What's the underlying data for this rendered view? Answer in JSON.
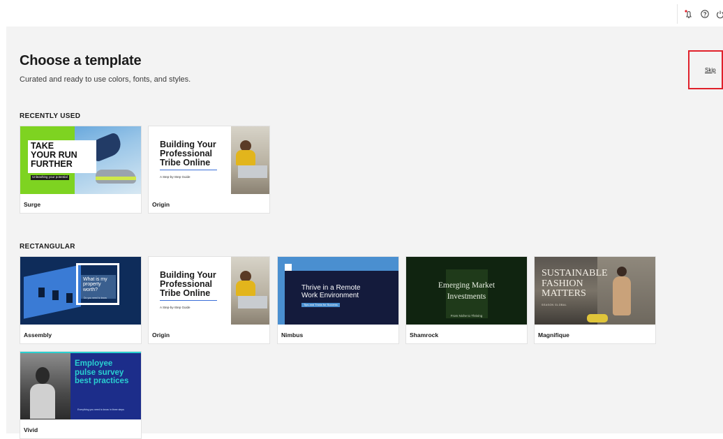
{
  "header": {
    "title": "Choose a template",
    "subtitle": "Curated and ready to use colors, fonts, and styles.",
    "skip_label": "Skip"
  },
  "top_icons": [
    "sparkle-bell-icon",
    "help-icon",
    "power-icon"
  ],
  "sections": {
    "recent": {
      "label": "RECENTLY USED"
    },
    "rect": {
      "label": "RECTANGULAR"
    }
  },
  "cards": {
    "surge": {
      "name": "Surge",
      "thumb_lines": [
        "TAKE",
        "YOUR RUN",
        "FURTHER"
      ],
      "thumb_tag": "Unleashing your potential",
      "accent": "#7ed321"
    },
    "origin_recent": {
      "name": "Origin",
      "thumb_lines": [
        "Building Your",
        "Professional",
        "Tribe Online"
      ],
      "thumb_tag": "A Step-by-Step Guide"
    },
    "assembly": {
      "name": "Assembly",
      "thumb_lines": [
        "What is my",
        "property",
        "worth?"
      ],
      "thumb_tag": "Do you need to know",
      "accent": "#3a7bd5"
    },
    "origin": {
      "name": "Origin",
      "thumb_lines": [
        "Building Your",
        "Professional",
        "Tribe Online"
      ],
      "thumb_tag": "A Step-by-Step Guide"
    },
    "nimbus": {
      "name": "Nimbus",
      "thumb_lines": [
        "Thrive in a Remote",
        "Work Environment"
      ],
      "thumb_tag": "Tips and Tricks for Success",
      "accent": "#4a8fd0"
    },
    "shamrock": {
      "name": "Shamrock",
      "thumb_lines": [
        "Emerging Market",
        "Investments"
      ],
      "thumb_tag": "From Niche to Thriving",
      "accent": "#1f3a1a"
    },
    "magnifique": {
      "name": "Magnifique",
      "thumb_lines": [
        "SUSTAINABLE",
        "FASHION",
        "MATTERS"
      ],
      "thumb_tag": "SEASON GLOBAL"
    },
    "vivid": {
      "name": "Vivid",
      "thumb_lines": [
        "Employee",
        "pulse survey",
        "best practices"
      ],
      "thumb_tag": "Everything you need to know in three steps",
      "accent": "#2ad0d0"
    }
  }
}
